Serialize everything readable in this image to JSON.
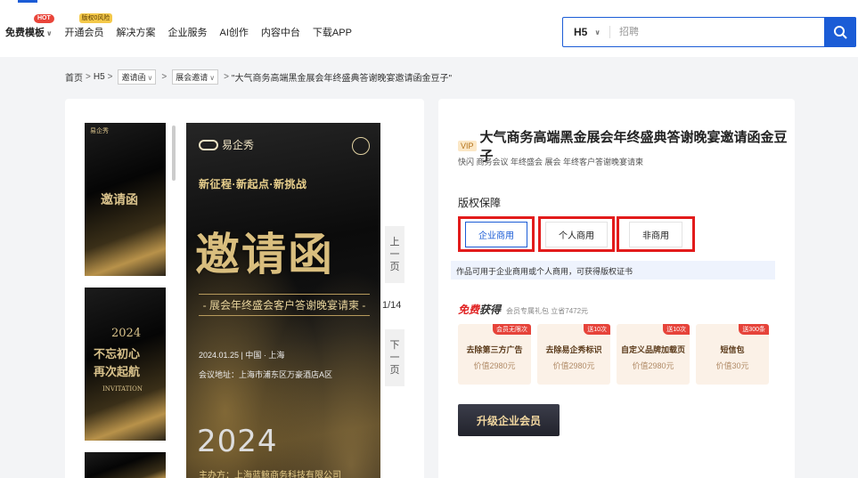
{
  "nav": {
    "items": [
      {
        "label": "免费模板",
        "badge": "HOT"
      },
      {
        "label": "开通会员",
        "badge": "版权0风险"
      },
      {
        "label": "解决方案"
      },
      {
        "label": "企业服务"
      },
      {
        "label": "AI创作"
      },
      {
        "label": "内容中台"
      },
      {
        "label": "下载APP"
      }
    ]
  },
  "search": {
    "type": "H5",
    "placeholder": "招聘"
  },
  "breadcrumb": {
    "home": "首页",
    "h5": "H5",
    "cat1": "邀请函",
    "cat2": "展会邀请",
    "current": "\"大气商务高端黑金展会年终盛典答谢晚宴邀请函金豆子\""
  },
  "thumbs": {
    "t1_logo": "易企秀",
    "t1_text": "邀请函",
    "t2_year": "2024",
    "t2_line1": "不忘初心",
    "t2_line2": "再次起航",
    "t2_line3": "INVITATION"
  },
  "preview": {
    "logo": "易企秀",
    "slogan": "新征程·新起点·新挑战",
    "big_title": "邀请函",
    "subtitle": "- 展会年终盛会客户答谢晚宴请柬 -",
    "date_line": "2024.01.25 | 中国 · 上海",
    "address": "会议地址：上海市浦东区万豪酒店A区",
    "year": "2024",
    "host": "主办方：上海蓝鲸商务科技有限公司"
  },
  "pager": {
    "prev": [
      "上",
      "一",
      "页"
    ],
    "next": [
      "下",
      "一",
      "页"
    ],
    "count": "1/14"
  },
  "product": {
    "vip": "VIP",
    "title": "大气商务高端黑金展会年终盛典答谢晚宴邀请函金豆子",
    "tags": "快闪 商务会议 年终盛会 展会 年终客户答谢晚宴请柬",
    "license_label": "版权保障",
    "licenses": [
      "企业商用",
      "个人商用",
      "非商用"
    ],
    "license_note": "作品可用于企业商用或个人商用，可获得版权证书",
    "free_title_red": "免费",
    "free_title_dark": "获得",
    "free_sub": "会员专属礼包 立省7472元",
    "benefits": [
      {
        "badge": "会员无限次",
        "name": "去除第三方广告",
        "price": "价值2980元"
      },
      {
        "badge": "送10次",
        "name": "去除易企秀标识",
        "price": "价值2980元"
      },
      {
        "badge": "送10次",
        "name": "自定义品牌加载页",
        "price": "价值2980元"
      },
      {
        "badge": "送300条",
        "name": "短信包",
        "price": "价值30元"
      }
    ],
    "upgrade": "升级企业会员"
  }
}
